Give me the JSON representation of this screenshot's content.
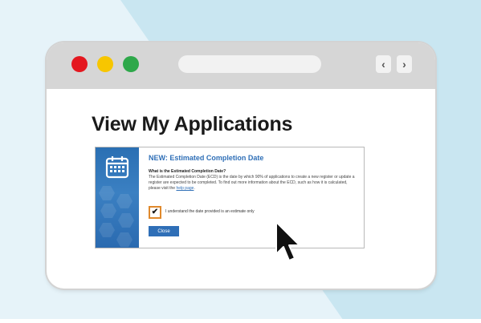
{
  "browser": {
    "back_symbol": "‹",
    "forward_symbol": "›",
    "dot_colors": {
      "red": "#e4171f",
      "yellow": "#f7c600",
      "green": "#2ea84a"
    }
  },
  "page": {
    "title": "View My Applications"
  },
  "modal": {
    "heading": "NEW: Estimated Completion Date",
    "question": "What is the Estimated Completion Date?",
    "body_text": "The Estimated Completion Date (ECD) is the date by which 90% of applications to create a new register or update a register are expected to be completed. To find out more information about the ECD, such as how it is calculated, please visit the",
    "link_text": "help page",
    "checkbox_label": "I understand the date provided is an estimate only",
    "checkbox_checked": true,
    "close_label": "Close",
    "accent_color": "#2f6fb7"
  }
}
